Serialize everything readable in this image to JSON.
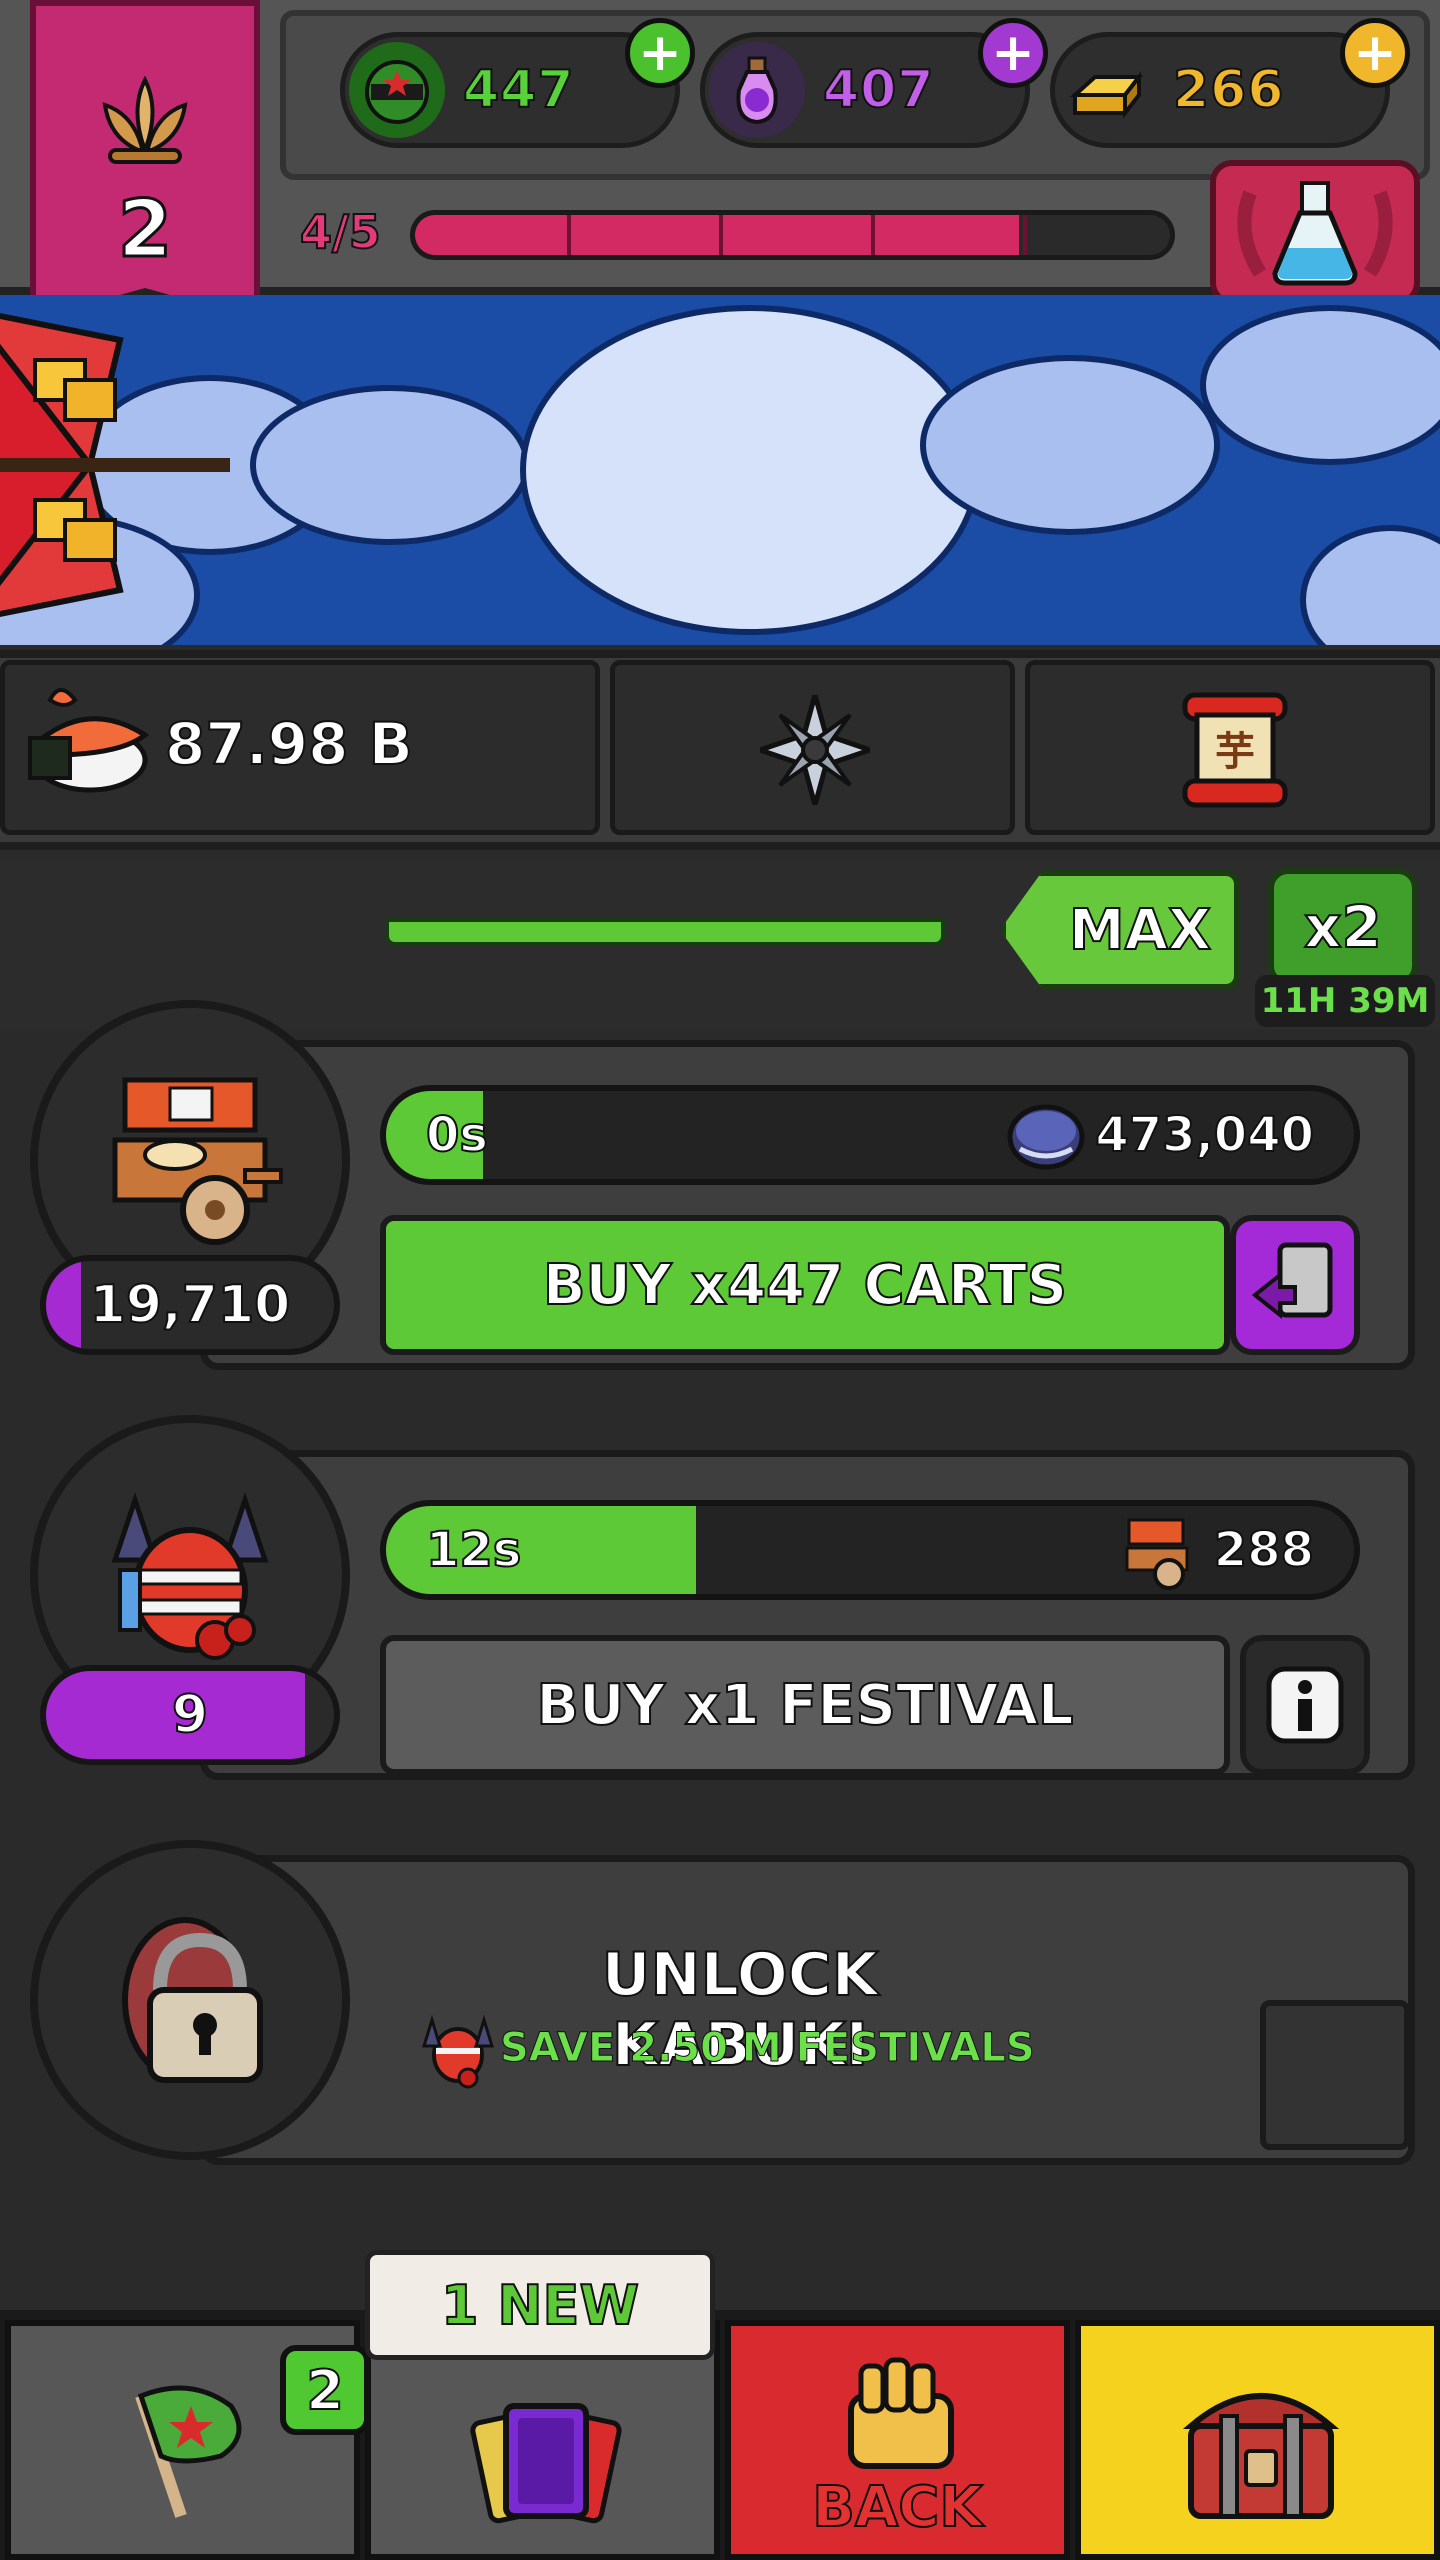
{
  "banner": {
    "level": "2"
  },
  "currencies": {
    "ninjas": {
      "value": "447",
      "color": "#59d13a"
    },
    "potions": {
      "value": "407",
      "color": "#c15fe8"
    },
    "gold": {
      "value": "266",
      "color": "#f0b62c"
    }
  },
  "level_progress": {
    "label": "4/5",
    "current": 4,
    "total": 5
  },
  "resources": {
    "sushi_value": "87.98 B"
  },
  "boost": {
    "max_label": "MAX",
    "multiplier_label": "x2",
    "timer": "11H 39M"
  },
  "businesses": [
    {
      "name": "carts",
      "owned": "19,710",
      "owned_fill": 0.12,
      "time_label": "0s",
      "time_fill": 0.1,
      "income": "473,040",
      "buy_label": "BUY x447 CARTS"
    },
    {
      "name": "festival",
      "owned": "9",
      "owned_fill": 0.9,
      "time_label": "12s",
      "time_fill": 0.32,
      "income": "288",
      "buy_label": "BUY x1 FESTIVAL"
    }
  ],
  "locked": {
    "title": "UNLOCK KABUKI",
    "requirement": "SAVE 2.50 M FESTIVALS"
  },
  "nav": {
    "flag_badge": "2",
    "cards_tip": "1 NEW",
    "back_label": "BACK"
  }
}
